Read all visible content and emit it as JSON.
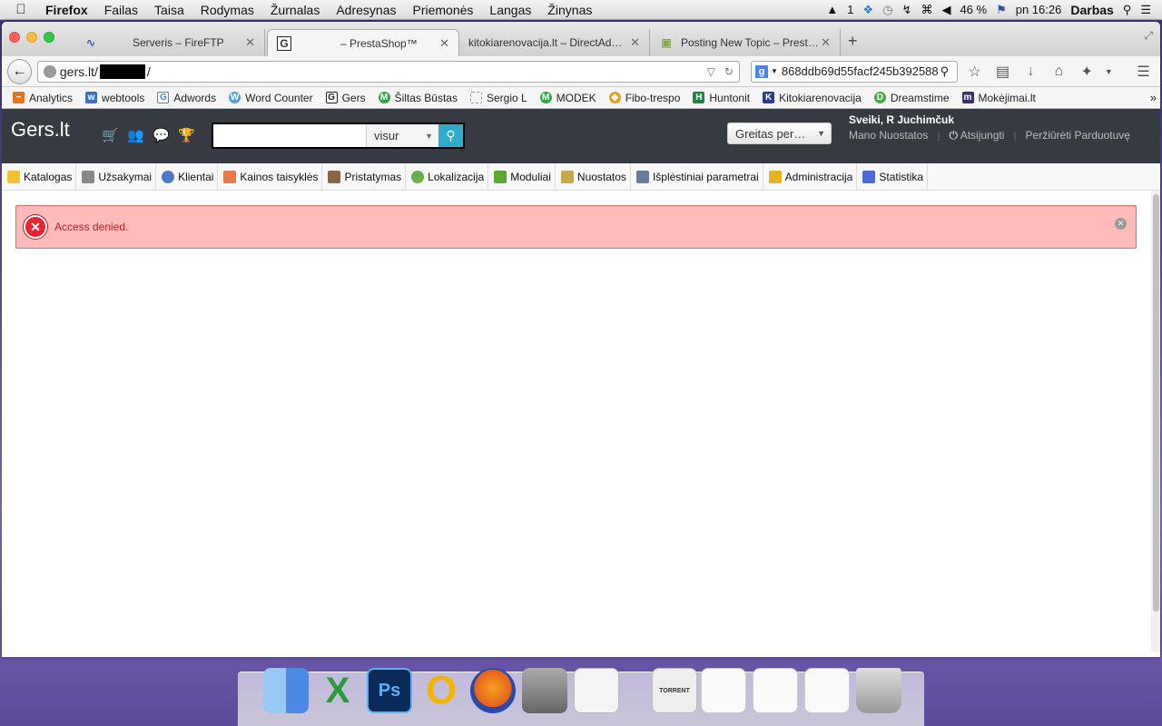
{
  "menubar": {
    "app": "Firefox",
    "items": [
      "Failas",
      "Taisa",
      "Rodymas",
      "Žurnalas",
      "Adresynas",
      "Priemonės",
      "Langas",
      "Žinynas"
    ],
    "status": {
      "adobe_count": "1",
      "battery": "46 %",
      "clock": "pn 16:26",
      "user": "Darbas"
    }
  },
  "tabs": [
    {
      "title": "Serveris – FireFTP",
      "active": false
    },
    {
      "title": "– PrestaShop™",
      "active": true
    },
    {
      "title": "kitokiarenovacija.lt – DirectAd…",
      "active": false
    },
    {
      "title": "Posting New Topic – Prest…",
      "active": false
    }
  ],
  "navbar": {
    "url_prefix": "gers.lt/",
    "url_suffix": "/",
    "search_value": "868ddb69d55facf245b392588"
  },
  "bookmarks": [
    {
      "label": "Analytics",
      "icon": "analytics-icon",
      "color": "#e8711c"
    },
    {
      "label": "webtools",
      "icon": "webtools-icon",
      "color": "#3a6fc4"
    },
    {
      "label": "Adwords",
      "icon": "adwords-icon",
      "color": "#4285f4"
    },
    {
      "label": "Word Counter",
      "icon": "word-counter-icon",
      "color": "#5aa0d8"
    },
    {
      "label": "Gers",
      "icon": "gers-icon",
      "color": "#222222"
    },
    {
      "label": "Šiltas Būstas",
      "icon": "siltas-bustas-icon",
      "color": "#2fa84a"
    },
    {
      "label": "Sergio L",
      "icon": "sergio-icon",
      "color": "#bbbbbb"
    },
    {
      "label": "MODEK",
      "icon": "modek-icon",
      "color": "#2fa84a"
    },
    {
      "label": "Fibo-trespo",
      "icon": "fibo-icon",
      "color": "#e6a317"
    },
    {
      "label": "Huntonit",
      "icon": "huntonit-icon",
      "color": "#1a8a3a"
    },
    {
      "label": "Kitokiarenovacija",
      "icon": "kitokiarenovacija-icon",
      "color": "#2a3a8a"
    },
    {
      "label": "Dreamstime",
      "icon": "dreamstime-icon",
      "color": "#4aa84a"
    },
    {
      "label": "Mokėjimai.lt",
      "icon": "mokejimai-icon",
      "color": "#333366"
    }
  ],
  "prestashop": {
    "logo": "Gers.lt",
    "search_scope": "visur",
    "quick_access": "Greitas per…",
    "welcome": "Sveiki, R Juchimčuk",
    "my_settings": "Mano Nuostatos",
    "logout": "Atsijungti",
    "view_shop": "Peržiūrėti Parduotuvę",
    "menu": [
      {
        "label": "Katalogas",
        "icon": "folder-icon",
        "color": "#f2c230"
      },
      {
        "label": "Užsakymai",
        "icon": "cart-icon",
        "color": "#888888"
      },
      {
        "label": "Klientai",
        "icon": "user-icon",
        "color": "#4a7ac8"
      },
      {
        "label": "Kainos taisyklės",
        "icon": "price-rules-icon",
        "color": "#e87a4a"
      },
      {
        "label": "Pristatymas",
        "icon": "truck-icon",
        "color": "#886644"
      },
      {
        "label": "Lokalizacija",
        "icon": "globe-icon",
        "color": "#6ab04a"
      },
      {
        "label": "Moduliai",
        "icon": "puzzle-icon",
        "color": "#5aa832"
      },
      {
        "label": "Nuostatos",
        "icon": "settings-doc-icon",
        "color": "#c8a848"
      },
      {
        "label": "Išplėstiniai parametrai",
        "icon": "wrench-icon",
        "color": "#6a7a9a"
      },
      {
        "label": "Administracija",
        "icon": "key-icon",
        "color": "#e6b422"
      },
      {
        "label": "Statistika",
        "icon": "bar-chart-icon",
        "color": "#4a6ad8"
      }
    ]
  },
  "alert": {
    "message": "Access denied."
  },
  "dock": [
    {
      "name": "finder-icon",
      "color": "#5a9ae6",
      "glyph": ""
    },
    {
      "name": "excel-icon",
      "color": "#2a9a3a",
      "glyph": "X"
    },
    {
      "name": "photoshop-icon",
      "color": "#0a2a5a",
      "glyph": "Ps"
    },
    {
      "name": "opera-icon",
      "color": "#f2b400",
      "glyph": "O"
    },
    {
      "name": "firefox-icon",
      "color": "#e8601a",
      "glyph": ""
    },
    {
      "name": "transmit-icon",
      "color": "#888888",
      "glyph": ""
    },
    {
      "name": "textedit-icon",
      "color": "#dddddd",
      "glyph": ""
    },
    {
      "name": "torrent-icon",
      "color": "#eeeeee",
      "glyph": ""
    },
    {
      "name": "window-thumb-1-icon",
      "color": "#f4f4f4",
      "glyph": ""
    },
    {
      "name": "window-thumb-2-icon",
      "color": "#f4f4f4",
      "glyph": ""
    },
    {
      "name": "window-thumb-3-icon",
      "color": "#f4f4f4",
      "glyph": ""
    },
    {
      "name": "trash-icon",
      "color": "#cccccc",
      "glyph": ""
    }
  ]
}
